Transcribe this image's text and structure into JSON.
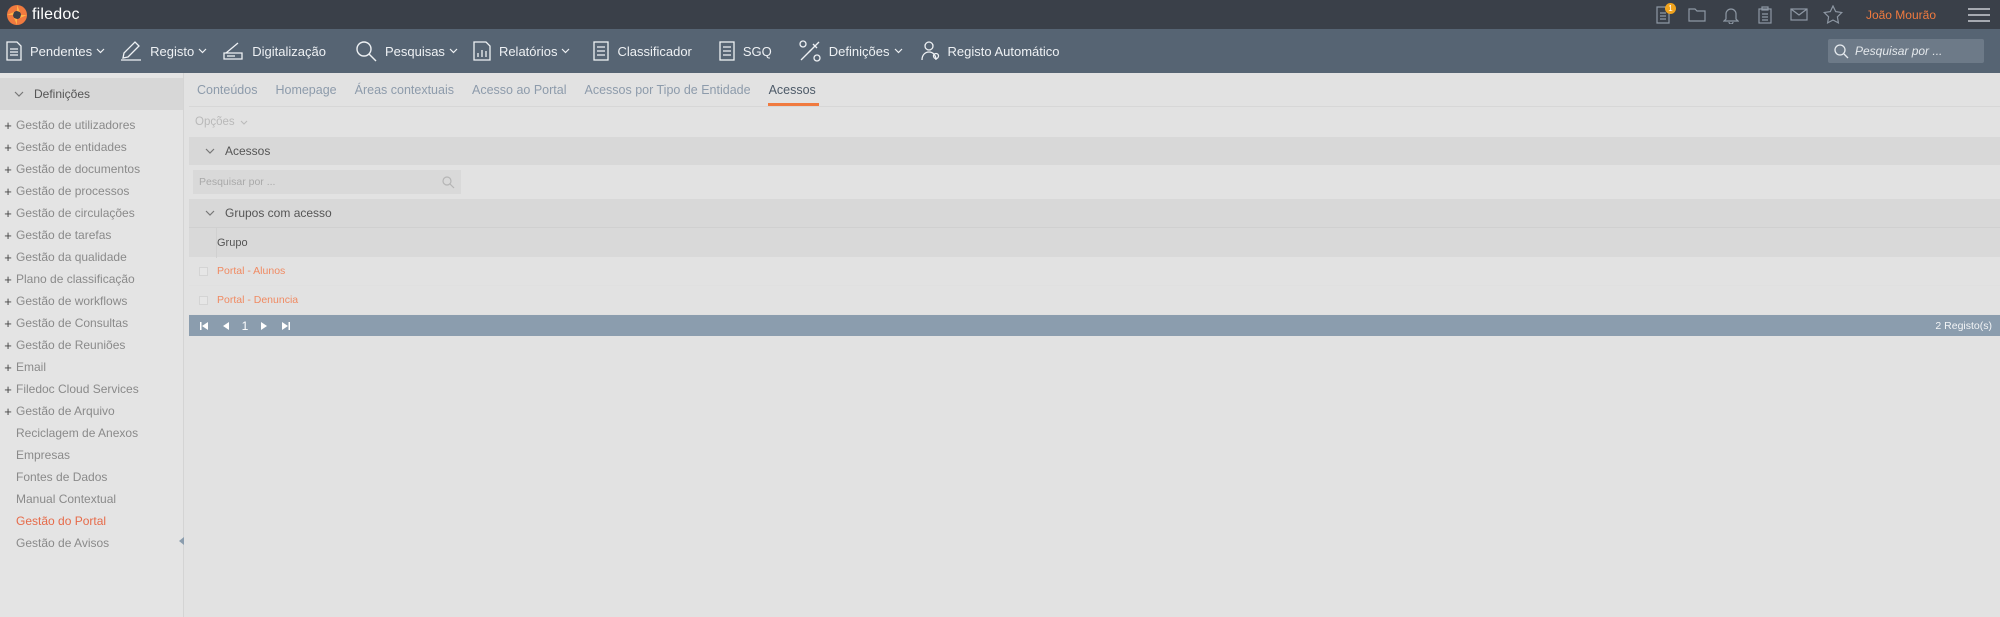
{
  "app": {
    "logo_text": "filedoc"
  },
  "topbar": {
    "notification_count": "1",
    "user_name": "João Mourão"
  },
  "nav": {
    "items": [
      {
        "label": "Pendentes",
        "icon": "document-icon",
        "dropdown": true
      },
      {
        "label": "Registo",
        "icon": "pencil-icon",
        "dropdown": true
      },
      {
        "label": "Digitalização",
        "icon": "scanner-icon",
        "dropdown": false
      },
      {
        "label": "Pesquisas",
        "icon": "search-icon",
        "dropdown": true
      },
      {
        "label": "Relatórios",
        "icon": "report-icon",
        "dropdown": true
      },
      {
        "label": "Classificador",
        "icon": "classifier-icon",
        "dropdown": false
      },
      {
        "label": "SGQ",
        "icon": "checklist-icon",
        "dropdown": false
      },
      {
        "label": "Definições",
        "icon": "tools-icon",
        "dropdown": true
      },
      {
        "label": "Registo Automático",
        "icon": "robot-icon",
        "dropdown": false
      }
    ],
    "search_placeholder": "Pesquisar por ..."
  },
  "sidebar": {
    "title": "Definições",
    "items": [
      {
        "label": "Gestão de utilizadores",
        "expandable": true
      },
      {
        "label": "Gestão de entidades",
        "expandable": true
      },
      {
        "label": "Gestão de documentos",
        "expandable": true
      },
      {
        "label": "Gestão de processos",
        "expandable": true
      },
      {
        "label": "Gestão de circulações",
        "expandable": true
      },
      {
        "label": "Gestão de tarefas",
        "expandable": true
      },
      {
        "label": "Gestão da qualidade",
        "expandable": true
      },
      {
        "label": "Plano de classificação",
        "expandable": true
      },
      {
        "label": "Gestão de workflows",
        "expandable": true
      },
      {
        "label": "Gestão de Consultas",
        "expandable": true
      },
      {
        "label": "Gestão de Reuniões",
        "expandable": true
      },
      {
        "label": "Email",
        "expandable": true
      },
      {
        "label": "Filedoc Cloud Services",
        "expandable": true
      },
      {
        "label": "Gestão de Arquivo",
        "expandable": true
      },
      {
        "label": "Reciclagem de Anexos",
        "expandable": false
      },
      {
        "label": "Empresas",
        "expandable": false
      },
      {
        "label": "Fontes de Dados",
        "expandable": false
      },
      {
        "label": "Manual Contextual",
        "expandable": false
      },
      {
        "label": "Gestão do Portal",
        "expandable": false,
        "active": true
      },
      {
        "label": "Gestão de Avisos",
        "expandable": false
      }
    ]
  },
  "main": {
    "tabs": [
      {
        "label": "Conteúdos"
      },
      {
        "label": "Homepage"
      },
      {
        "label": "Áreas contextuais"
      },
      {
        "label": "Acesso ao Portal"
      },
      {
        "label": "Acessos por Tipo de Entidade"
      },
      {
        "label": "Acessos",
        "active": true
      }
    ],
    "options_label": "Opções",
    "section_acessos": "Acessos",
    "search_placeholder": "Pesquisar por ...",
    "section_grupos": "Grupos com acesso",
    "table": {
      "column_header": "Grupo",
      "rows": [
        "Portal - Alunos",
        "Portal - Denuncia"
      ]
    },
    "pager": {
      "current_page": "1",
      "records": "2 Registo(s)"
    }
  },
  "colors": {
    "topbar": "#3a4049",
    "navbar": "#566473",
    "accent": "#f07a3f",
    "pager": "#8b9dae",
    "link": "#f08a62"
  }
}
